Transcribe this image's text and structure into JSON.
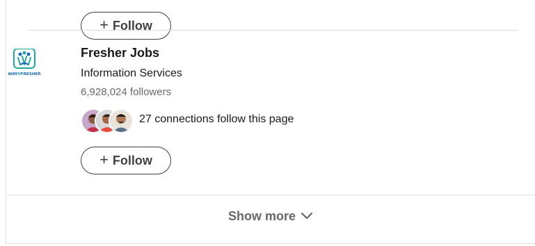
{
  "top_follow": {
    "plus": "+",
    "label": "Follow"
  },
  "company": {
    "logo_icon": "wayfresher-logo",
    "logo_text": "WAYOFRESHER",
    "name": "Fresher Jobs",
    "industry": "Information Services",
    "followers": "6,928,024 followers",
    "connections_text": "27 connections follow this page"
  },
  "bottom_follow": {
    "plus": "+",
    "label": "Follow"
  },
  "show_more": {
    "label": "Show more",
    "icon": "chevron-down-icon"
  },
  "colors": {
    "logo_teal": "#1fa8a0",
    "logo_blue": "#1565c0",
    "text_muted": "#666666"
  }
}
